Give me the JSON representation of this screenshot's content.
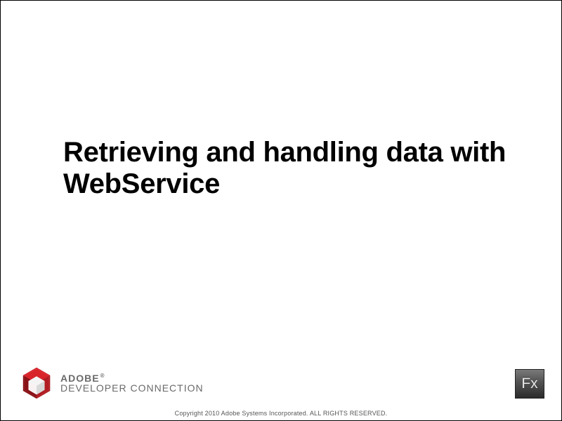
{
  "title": "Retrieving and handling data with WebService",
  "brand": {
    "line1": "ADOBE",
    "reg": "®",
    "line2": "DEVELOPER CONNECTION"
  },
  "fx_label": "Fx",
  "copyright": "Copyright 2010  Adobe Systems Incorporated.  ALL RIGHTS RESERVED."
}
